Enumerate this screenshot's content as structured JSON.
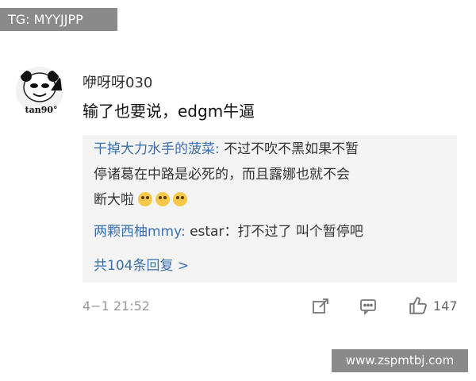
{
  "watermarks": {
    "top": "TG: MYYJJPP",
    "bottom": "www.zspmtbj.com"
  },
  "post": {
    "avatar_label": "tan90°",
    "username": "咿呀呀030",
    "content": "输了也要说，edgm牛逼",
    "time": "4−1 21:52",
    "like_count": "147"
  },
  "replies": [
    {
      "name": "干掉大力水手的菠菜:",
      "text_line1": "不过不吹不黑如果不暂",
      "text_line2": "停诸葛在中路是必死的，而且露娜也就不会",
      "text_line3": "断大啦",
      "emoji_count": 3
    },
    {
      "name": "两颗西柚mmy:",
      "text": "estar：打不过了 叫个暂停吧"
    }
  ],
  "more_replies": "共104条回复 >",
  "icons": [
    "share-icon",
    "comment-icon",
    "like-icon",
    "laughing-crying-emoji"
  ],
  "colors": {
    "link": "#3a6fb0",
    "reply_bg": "#f4f4f4",
    "watermark_bg": "#8a8a8a"
  }
}
